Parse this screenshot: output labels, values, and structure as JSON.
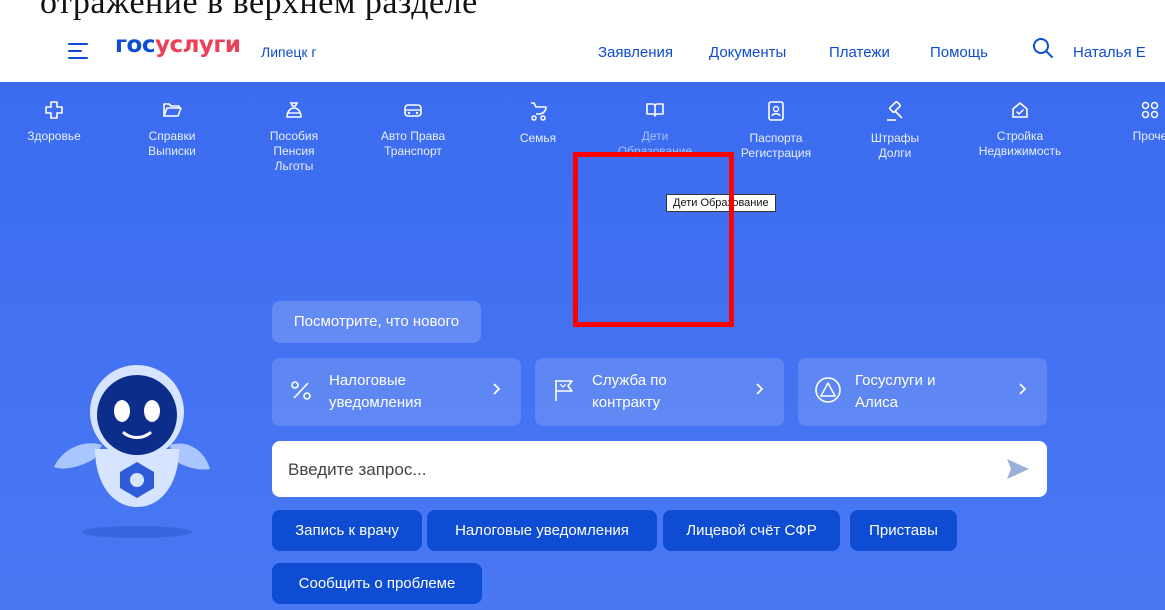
{
  "caption": "отражение в верхнем разделе",
  "header": {
    "logo_part1": "гос",
    "logo_part2": "услуги",
    "city": "Липецк г",
    "nav": [
      "Заявления",
      "Документы",
      "Платежи",
      "Помощь"
    ],
    "user": "Наталья Е"
  },
  "categories": [
    {
      "label": "Здоровье",
      "icon": "health-cross-icon"
    },
    {
      "label": "Справки\nВыписки",
      "icon": "folder-icon"
    },
    {
      "label": "Пособия\nПенсия\nЛьготы",
      "icon": "money-bag-icon"
    },
    {
      "label": "Авто Права\nТранспорт",
      "icon": "car-icon"
    },
    {
      "label": "Семья",
      "icon": "stroller-icon"
    },
    {
      "label": "Дети\nОбразование",
      "icon": "book-icon"
    },
    {
      "label": "Паспорта\nРегистрация",
      "icon": "passport-icon"
    },
    {
      "label": "Штрафы\nДолги",
      "icon": "gavel-icon"
    },
    {
      "label": "Стройка\nНедвижимость",
      "icon": "house-icon"
    },
    {
      "label": "Проче",
      "icon": "grid-icon"
    }
  ],
  "tooltip": "Дети Образование",
  "whats_new": "Посмотрите, что нового",
  "cards": [
    {
      "title": "Налоговые\nуведомления",
      "icon": "percent-icon"
    },
    {
      "title": "Служба по\nконтракту",
      "icon": "flag-icon"
    },
    {
      "title": "Госуслуги и\nАлиса",
      "icon": "alice-icon"
    }
  ],
  "search": {
    "placeholder": "Введите запрос..."
  },
  "chips": [
    "Запись к врачу",
    "Налоговые уведомления",
    "Лицевой счёт СФР",
    "Приставы",
    "Сообщить о проблеме"
  ],
  "colors": {
    "brand_blue": "#0d4cd3",
    "brand_red": "#ee3f58",
    "hero_bg": "#4a78f3",
    "highlight": "#ff0000"
  }
}
